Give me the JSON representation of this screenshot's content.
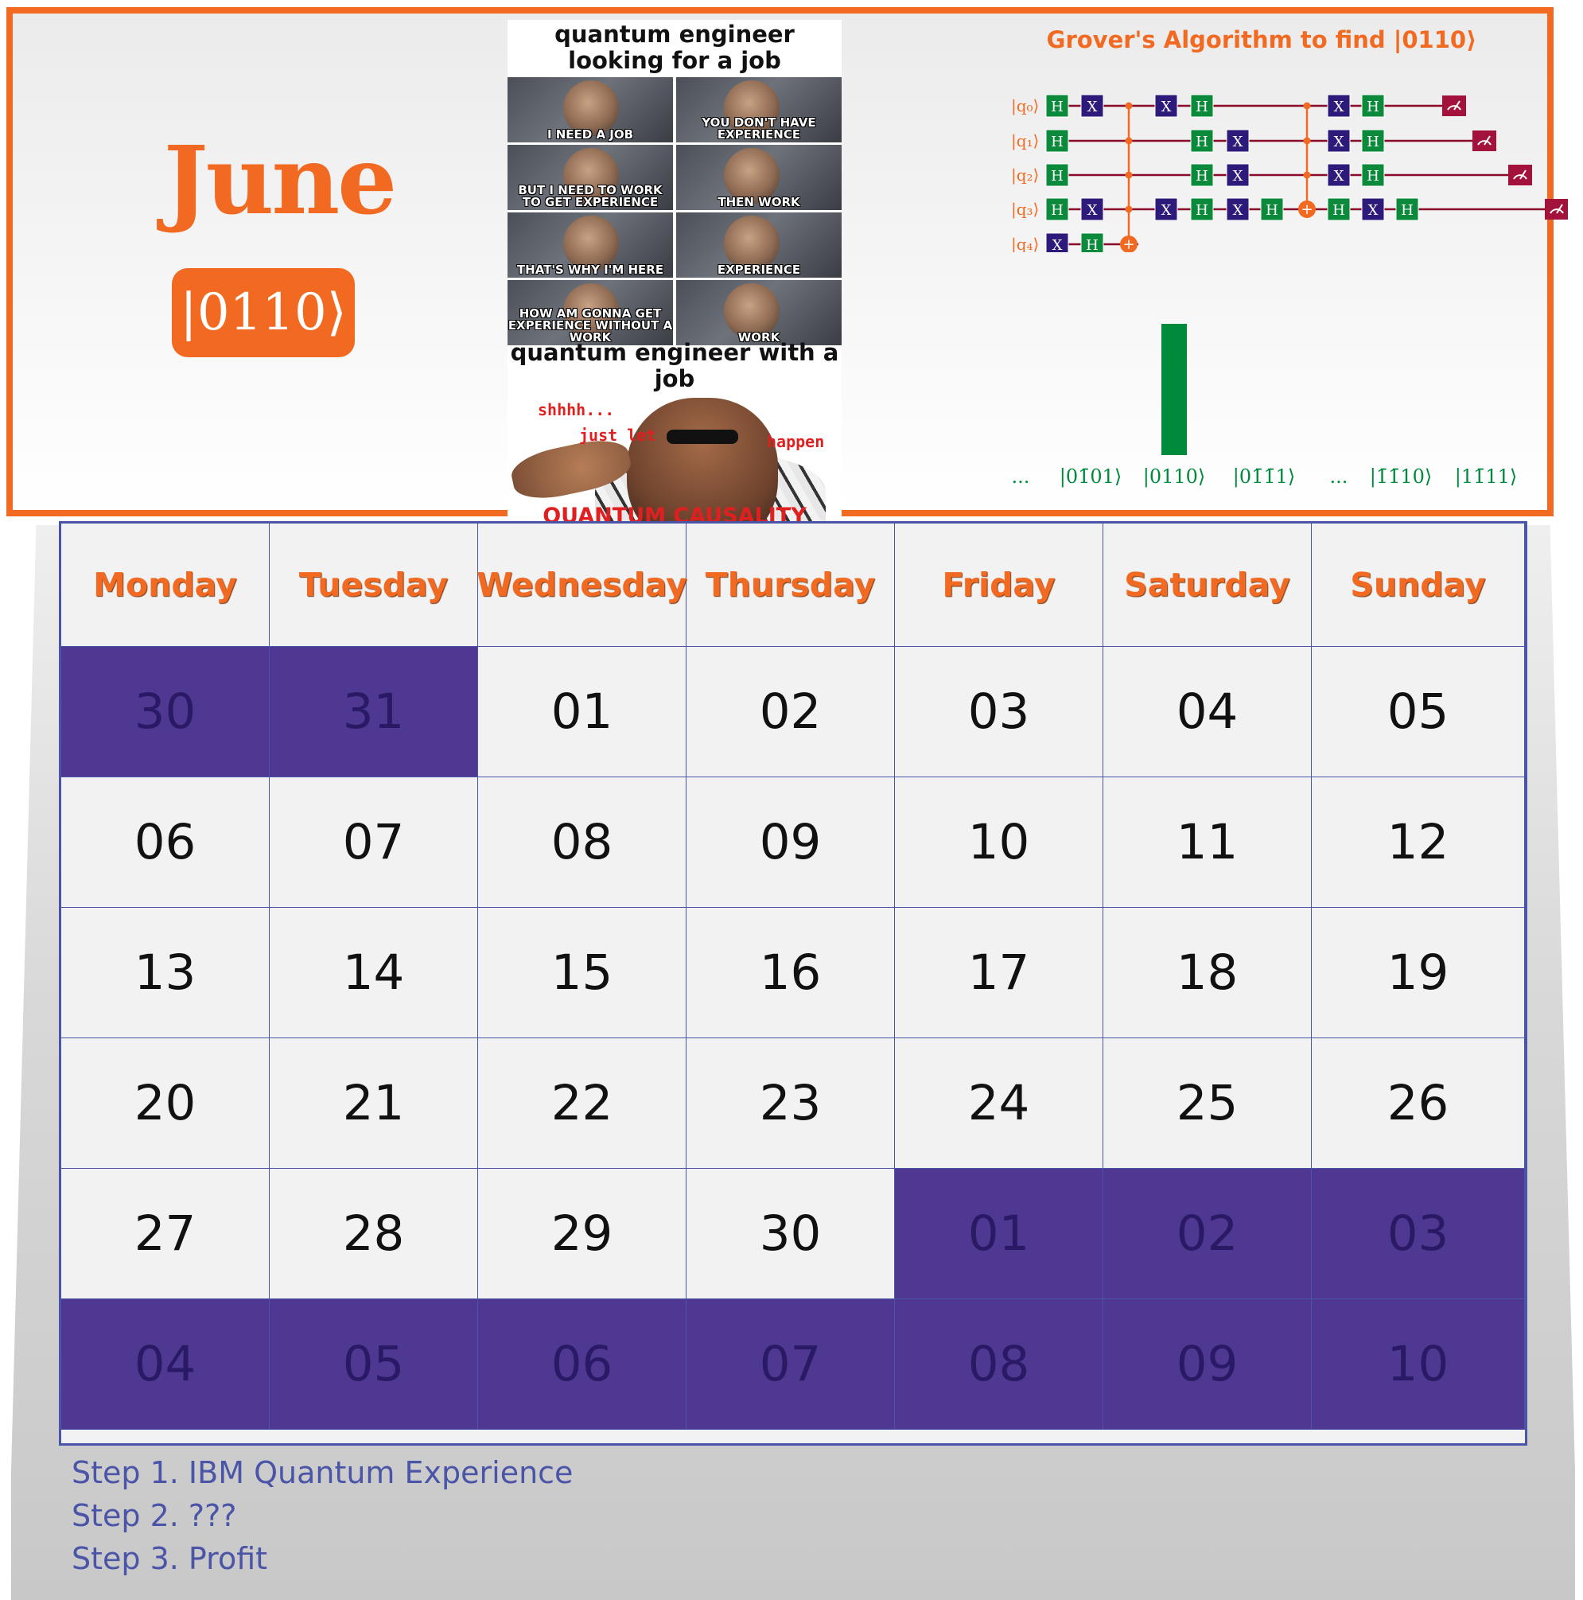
{
  "header": {
    "month": "June",
    "ket_label": "|0110⟩"
  },
  "meme": {
    "top_caption": "quantum engineer looking for a job",
    "panels": [
      "I NEED A JOB",
      "YOU DON'T HAVE EXPERIENCE",
      "BUT I NEED TO WORK TO GET EXPERIENCE",
      "THEN WORK",
      "THAT'S WHY I'M HERE",
      "EXPERIENCE",
      "HOW AM GONNA GET EXPERIENCE WITHOUT A WORK",
      "WORK"
    ],
    "bottom_caption": "quantum engineer with a job",
    "whisper_1": "shhhh...",
    "whisper_2": "just let",
    "whisper_3": "happen",
    "bottom_text": "QUANTUM CAUSALITY"
  },
  "grover": {
    "title": "Grover's Algorithm to find |0110⟩",
    "qubits": [
      "|q₀⟩",
      "|q₁⟩",
      "|q₂⟩",
      "|q₃⟩",
      "|q₄⟩"
    ],
    "gate_colors": {
      "H": "#0a8a3a",
      "X": "#2d1a7a",
      "measure": "#a3123a",
      "control": "#f26a21",
      "wire": "#8a0a2a"
    },
    "histogram_labels": [
      "...",
      "|01̄01⟩",
      "|0110⟩",
      "|01̄1̄1⟩",
      "...",
      "|1̄1̄10⟩",
      "|11̄11⟩"
    ],
    "histogram_values": [
      0,
      0,
      1,
      0,
      0,
      0,
      0
    ],
    "bar_color": "#008a3c"
  },
  "calendar": {
    "weekdays": [
      "Monday",
      "Tuesday",
      "Wednesday",
      "Thursday",
      "Friday",
      "Saturday",
      "Sunday"
    ],
    "weeks": [
      [
        {
          "d": "30",
          "o": true
        },
        {
          "d": "31",
          "o": true
        },
        {
          "d": "01",
          "o": false
        },
        {
          "d": "02",
          "o": false
        },
        {
          "d": "03",
          "o": false
        },
        {
          "d": "04",
          "o": false
        },
        {
          "d": "05",
          "o": false
        }
      ],
      [
        {
          "d": "06",
          "o": false
        },
        {
          "d": "07",
          "o": false
        },
        {
          "d": "08",
          "o": false
        },
        {
          "d": "09",
          "o": false
        },
        {
          "d": "10",
          "o": false
        },
        {
          "d": "11",
          "o": false
        },
        {
          "d": "12",
          "o": false
        }
      ],
      [
        {
          "d": "13",
          "o": false
        },
        {
          "d": "14",
          "o": false
        },
        {
          "d": "15",
          "o": false
        },
        {
          "d": "16",
          "o": false
        },
        {
          "d": "17",
          "o": false
        },
        {
          "d": "18",
          "o": false
        },
        {
          "d": "19",
          "o": false
        }
      ],
      [
        {
          "d": "20",
          "o": false
        },
        {
          "d": "21",
          "o": false
        },
        {
          "d": "22",
          "o": false
        },
        {
          "d": "23",
          "o": false
        },
        {
          "d": "24",
          "o": false
        },
        {
          "d": "25",
          "o": false
        },
        {
          "d": "26",
          "o": false
        }
      ],
      [
        {
          "d": "27",
          "o": false
        },
        {
          "d": "28",
          "o": false
        },
        {
          "d": "29",
          "o": false
        },
        {
          "d": "30",
          "o": false
        },
        {
          "d": "01",
          "o": true
        },
        {
          "d": "02",
          "o": true
        },
        {
          "d": "03",
          "o": true
        }
      ],
      [
        {
          "d": "04",
          "o": true
        },
        {
          "d": "05",
          "o": true
        },
        {
          "d": "06",
          "o": true
        },
        {
          "d": "07",
          "o": true
        },
        {
          "d": "08",
          "o": true
        },
        {
          "d": "09",
          "o": true
        },
        {
          "d": "10",
          "o": true
        }
      ]
    ],
    "other_month_color": "#4f3891"
  },
  "steps": [
    "Step 1. IBM Quantum Experience",
    "Step 2. ???",
    "Step 3. Profit"
  ]
}
